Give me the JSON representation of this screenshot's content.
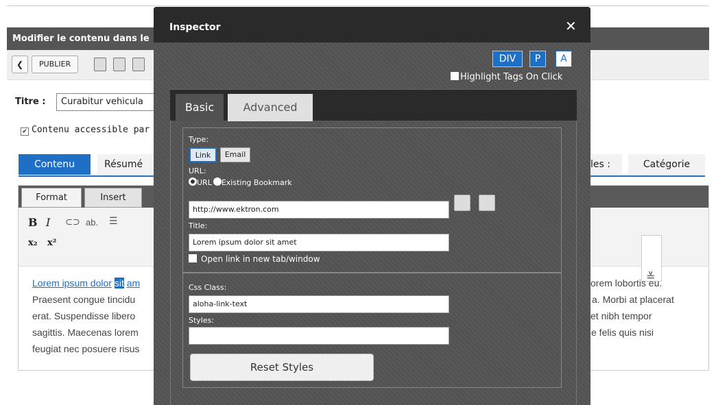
{
  "editor": {
    "window_title": "Modifier le contenu dans le",
    "toolbar": {
      "back_symbol": "❮",
      "publish_label": "PUBLIER"
    },
    "title_label": "Titre :",
    "title_value": "Curabitur vehicula",
    "accessible_label": "Contenu accessible par",
    "tabs": {
      "contenu": "Contenu",
      "resume": "Résumé",
      "modeles": "les :",
      "categorie": "Catégorie"
    },
    "format_tabs": [
      "Format",
      "Insert"
    ],
    "format_tools": {
      "bold": "B",
      "italic": "I",
      "link": "ab.",
      "subscript": "x₂",
      "superscript": "x²"
    },
    "expand_icon": "≚",
    "text": {
      "line1_link": "Lorem ipsum dolor",
      "line1_sel": "sit",
      "line1_rest": "am",
      "line1_right": "orem lobortis eu.",
      "line2_left": "Praesent congue tincidu",
      "line2_right": "a. Morbi at placerat",
      "line3_left": "erat. Suspendisse libero",
      "line3_right": "et nibh tempor",
      "line4_left": "sagittis. Maecenas lorem",
      "line4_right": "e felis quis nisi",
      "line5_left": "feugiat nec posuere risus"
    }
  },
  "inspector": {
    "title": "Inspector",
    "close_symbol": "✕",
    "tag_buttons": [
      "DIV",
      "P",
      "A"
    ],
    "highlight_label": "Highlight Tags On Click",
    "tabs": {
      "basic": "Basic",
      "advanced": "Advanced"
    },
    "type_label": "Type:",
    "type_link": "Link",
    "type_email": "Email",
    "url_label": "URL:",
    "radio_url": "URL",
    "radio_bookmark": "Existing Bookmark",
    "url_value": "http://www.ektron.com",
    "title_label": "Title:",
    "title_value": "Lorem ipsum dolor sit amet",
    "new_tab_label": "Open link in new tab/window",
    "css_class_label": "Css Class:",
    "css_class_value": "aloha-link-text",
    "styles_label": "Styles:",
    "styles_value": "",
    "reset_label": "Reset Styles"
  }
}
